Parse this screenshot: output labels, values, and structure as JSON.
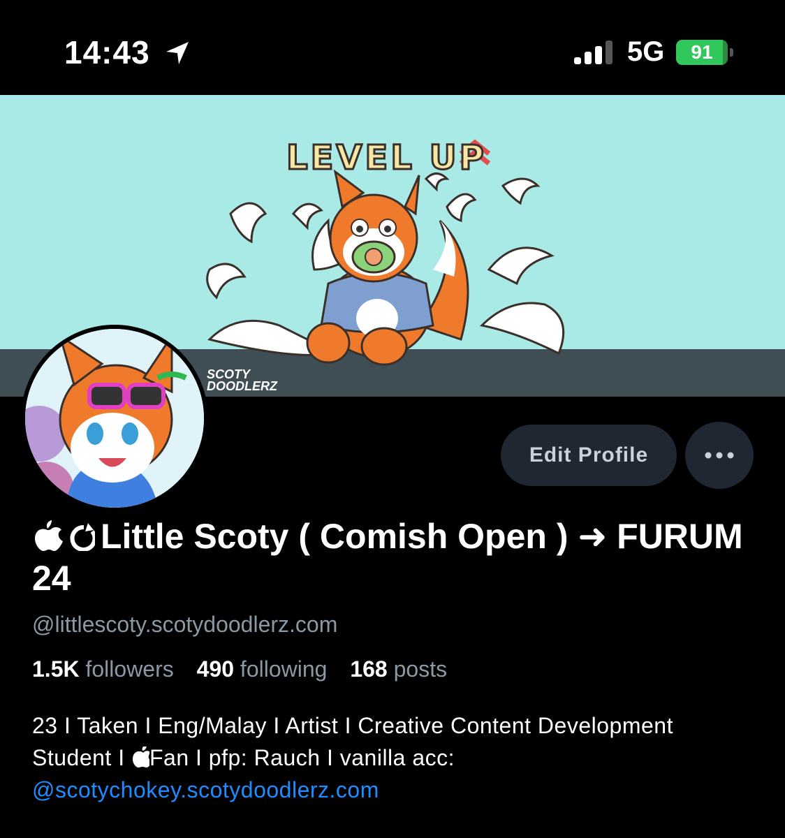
{
  "status_bar": {
    "time": "14:43",
    "network": "5G",
    "battery_percent": "91",
    "battery_level": 0.91,
    "signal_bars": 3,
    "signal_bars_total": 4
  },
  "banner": {
    "title": "LEVEL UP",
    "watermark_line1": "SCOTY",
    "watermark_line2": "DOODLERZ"
  },
  "buttons": {
    "edit_profile": "Edit Profile"
  },
  "profile": {
    "display_name": "Little Scoty ( Comish Open ) ➜ FURUM 24",
    "handle": "@littlescoty.scotydoodlerz.com",
    "stats": {
      "followers_count": "1.5K",
      "followers_label": "followers",
      "following_count": "490",
      "following_label": "following",
      "posts_count": "168",
      "posts_label": "posts"
    },
    "bio_part1": "23 I Taken I Eng/Malay I Artist I Creative Content Development Student I ",
    "bio_part2": "Fan I pfp: Rauch I vanilla acc:",
    "bio_link": "@scotychokey.scotydoodlerz.com"
  },
  "colors": {
    "background": "#000000",
    "secondary_text": "#8b98a5",
    "link": "#1d8cff",
    "button_bg": "#1e2732",
    "battery_green": "#30c85a",
    "banner_bg": "#a9e9e6"
  }
}
